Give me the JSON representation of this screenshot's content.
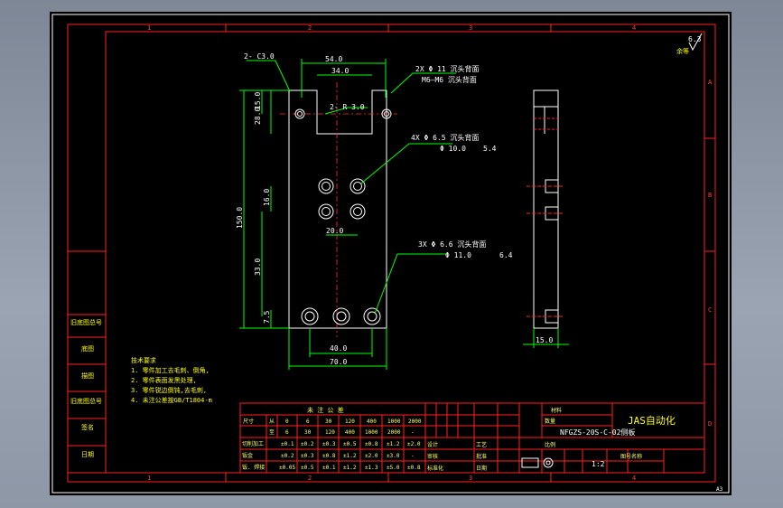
{
  "grid": {
    "top": [
      "1",
      "2",
      "3",
      "4"
    ],
    "bottom": [
      "1",
      "2",
      "3",
      "4"
    ],
    "right": [
      "A",
      "B",
      "C",
      "D"
    ]
  },
  "roughness": {
    "value": "6.3",
    "note": "余等"
  },
  "dims": {
    "d54": "54.0",
    "d34": "34.0",
    "chamfer_c3": "2- C3.0",
    "r3": "2- R 3.0",
    "d15": "15.0",
    "d28": "28.0",
    "d150": "150.0",
    "d16": "16.0",
    "d20": "20.0",
    "d33": "33.0",
    "d75": "7.5",
    "d40": "40.0",
    "d70": "70.0",
    "side15": "15.0"
  },
  "hole_notes": {
    "h1_line1": "2X Φ 11 沉头背面",
    "h1_line2": "M6—M6 沉头背面",
    "h2_line1": "4X Φ 6.5 沉头背面",
    "h2_line2": "Φ 10.0",
    "h2_depth": "5.4",
    "h3_line1": "3X Φ 6.6 沉头背面",
    "h3_line2": "Φ 11.0",
    "h3_depth": "6.4"
  },
  "tech_notes": [
    "技术要求",
    "1. 零件加工去毛刺、倒角,",
    "2. 零件表面发黑处理,",
    "3. 零件锐边倒钝,去毛刺,",
    "4. 未注公差按GB/T1804-m"
  ],
  "left_labels": [
    "旧底图总号",
    "底图",
    "描图",
    "旧底图总号",
    "签名",
    "日期"
  ],
  "tolerance": {
    "title": "未 注 公 差",
    "header_row1": [
      "尺寸",
      "从",
      "0",
      "6",
      "30",
      "120",
      "400",
      "1000",
      "2000"
    ],
    "header_row2": [
      "",
      "至",
      "6",
      "30",
      "120",
      "400",
      "1000",
      "2000",
      "-"
    ],
    "rows": [
      {
        "label": "切削加工",
        "values": [
          "±0.1",
          "±0.2",
          "±0.3",
          "±0.5",
          "±0.8",
          "±1.2",
          "±2.0"
        ]
      },
      {
        "label": "钣金",
        "values": [
          "±0.2",
          "±0.3",
          "±0.8",
          "±1.2",
          "±2.0",
          "±3.0",
          "-"
        ]
      },
      {
        "label": "钣. 焊接",
        "values": [
          "±0.05",
          "±0.5",
          "±0.1",
          "±1.2",
          "±1.3",
          "±5.0",
          "±0.8"
        ]
      }
    ]
  },
  "title_block": {
    "company": "JAS自动化",
    "drawing_no": "NFGZS-20S-C-02侧板",
    "material_lbl": "材料",
    "qty_lbl": "数量",
    "ratio_lbl": "比例",
    "row_labels": [
      "设计",
      "审核",
      "标准化",
      "工艺",
      "批准",
      "日期"
    ],
    "scale": "1:2",
    "sheet_lbl": "图号名称"
  },
  "corner": "A3"
}
